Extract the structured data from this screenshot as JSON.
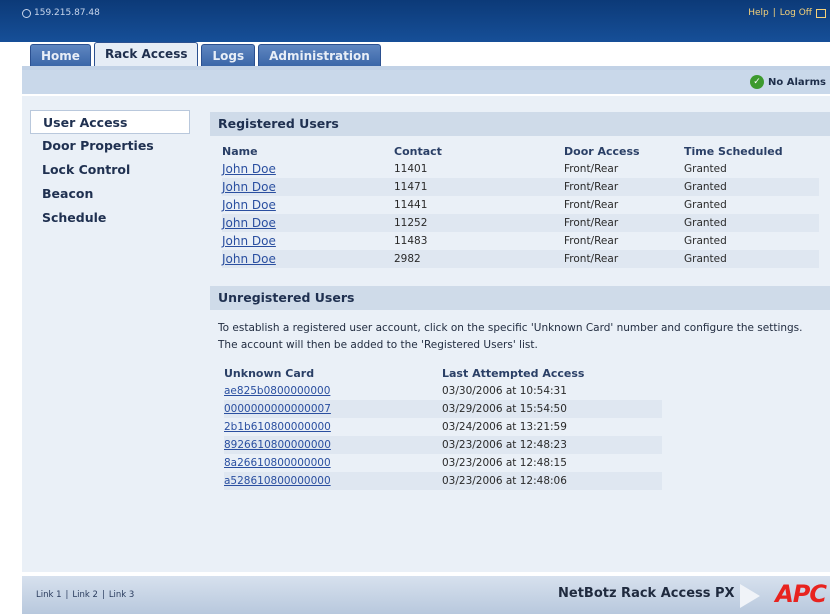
{
  "header": {
    "ip": "159.215.87.48",
    "help": "Help",
    "separator": "|",
    "logoff": "Log Off"
  },
  "tabs": [
    {
      "label": "Home"
    },
    {
      "label": "Rack Access",
      "active": true
    },
    {
      "label": "Logs"
    },
    {
      "label": "Administration"
    }
  ],
  "alarm": {
    "status": "No Alarms",
    "icon": "check-circle-icon",
    "color": "#3c9a2e"
  },
  "sidebar": {
    "items": [
      {
        "label": "User Access",
        "active": true
      },
      {
        "label": "Door Properties"
      },
      {
        "label": "Lock Control"
      },
      {
        "label": "Beacon"
      },
      {
        "label": "Schedule"
      }
    ]
  },
  "registered": {
    "title": "Registered Users",
    "columns": [
      "Name",
      "Contact",
      "Door Access",
      "Time Scheduled"
    ],
    "rows": [
      {
        "name": "John Doe",
        "contact": "11401",
        "door": "Front/Rear",
        "time": "Granted"
      },
      {
        "name": "John Doe",
        "contact": "11471",
        "door": "Front/Rear",
        "time": "Granted"
      },
      {
        "name": "John Doe",
        "contact": "11441",
        "door": "Front/Rear",
        "time": "Granted"
      },
      {
        "name": "John Doe",
        "contact": "11252",
        "door": "Front/Rear",
        "time": "Granted"
      },
      {
        "name": "John Doe",
        "contact": "11483",
        "door": "Front/Rear",
        "time": "Granted"
      },
      {
        "name": "John Doe",
        "contact": "2982",
        "door": "Front/Rear",
        "time": "Granted"
      }
    ]
  },
  "unregistered": {
    "title": "Unregistered Users",
    "description": "To establish a registered user account, click on the specific 'Unknown Card' number and configure the settings. The account will then be added to the 'Registered Users' list.",
    "columns": [
      "Unknown Card",
      "Last Attempted Access"
    ],
    "rows": [
      {
        "card": "ae825b0800000000",
        "access": "03/30/2006 at 10:54:31"
      },
      {
        "card": "0000000000000007",
        "access": "03/29/2006 at 15:54:50"
      },
      {
        "card": "2b1b610800000000",
        "access": "03/24/2006 at 13:21:59"
      },
      {
        "card": "8926610800000000",
        "access": "03/23/2006 at 12:48:23"
      },
      {
        "card": "8a26610800000000",
        "access": "03/23/2006 at 12:48:15"
      },
      {
        "card": "a528610800000000",
        "access": "03/23/2006 at 12:48:06"
      }
    ]
  },
  "footer": {
    "links": [
      "Link 1",
      "Link 2",
      "Link 3"
    ],
    "separator": "|",
    "product": "NetBotz Rack Access PX",
    "logo": "APC",
    "logo_color": "#e8231f"
  }
}
